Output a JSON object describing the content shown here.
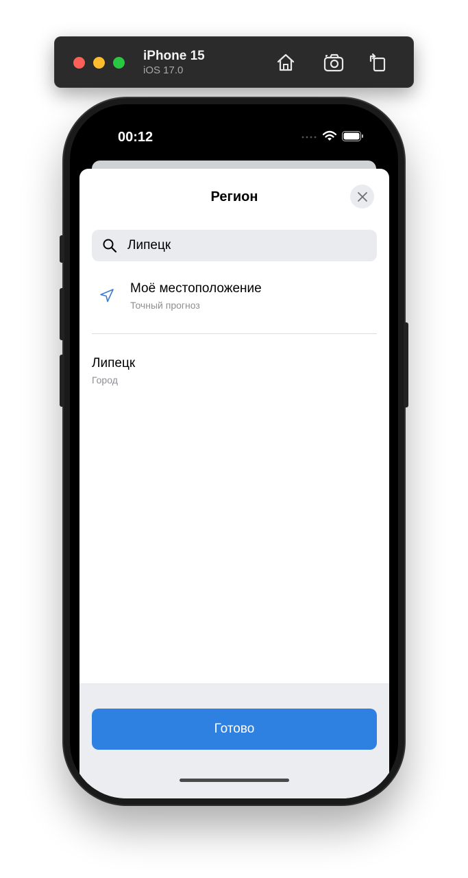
{
  "simulator": {
    "device_name": "iPhone 15",
    "os_version": "iOS 17.0",
    "toolbar_icons": [
      "home-icon",
      "screenshot-icon",
      "rotate-icon"
    ]
  },
  "status_bar": {
    "time": "00:12",
    "icons": [
      "cellular-icon",
      "wifi-icon",
      "battery-icon"
    ]
  },
  "sheet": {
    "title": "Регион",
    "close_icon": "close-icon",
    "search": {
      "value": "Липецк",
      "icon": "search-icon"
    },
    "my_location": {
      "icon": "location-arrow-icon",
      "title": "Моё местоположение",
      "subtitle": "Точный прогноз"
    },
    "results": [
      {
        "title": "Липецк",
        "subtitle": "Город"
      }
    ],
    "done_label": "Готово"
  },
  "colors": {
    "accent": "#2f81e1",
    "location_icon": "#3a7bd5",
    "secondary_text": "#8e8e93",
    "search_background": "#e9ebef",
    "bottom_bar": "#ebedf1"
  }
}
